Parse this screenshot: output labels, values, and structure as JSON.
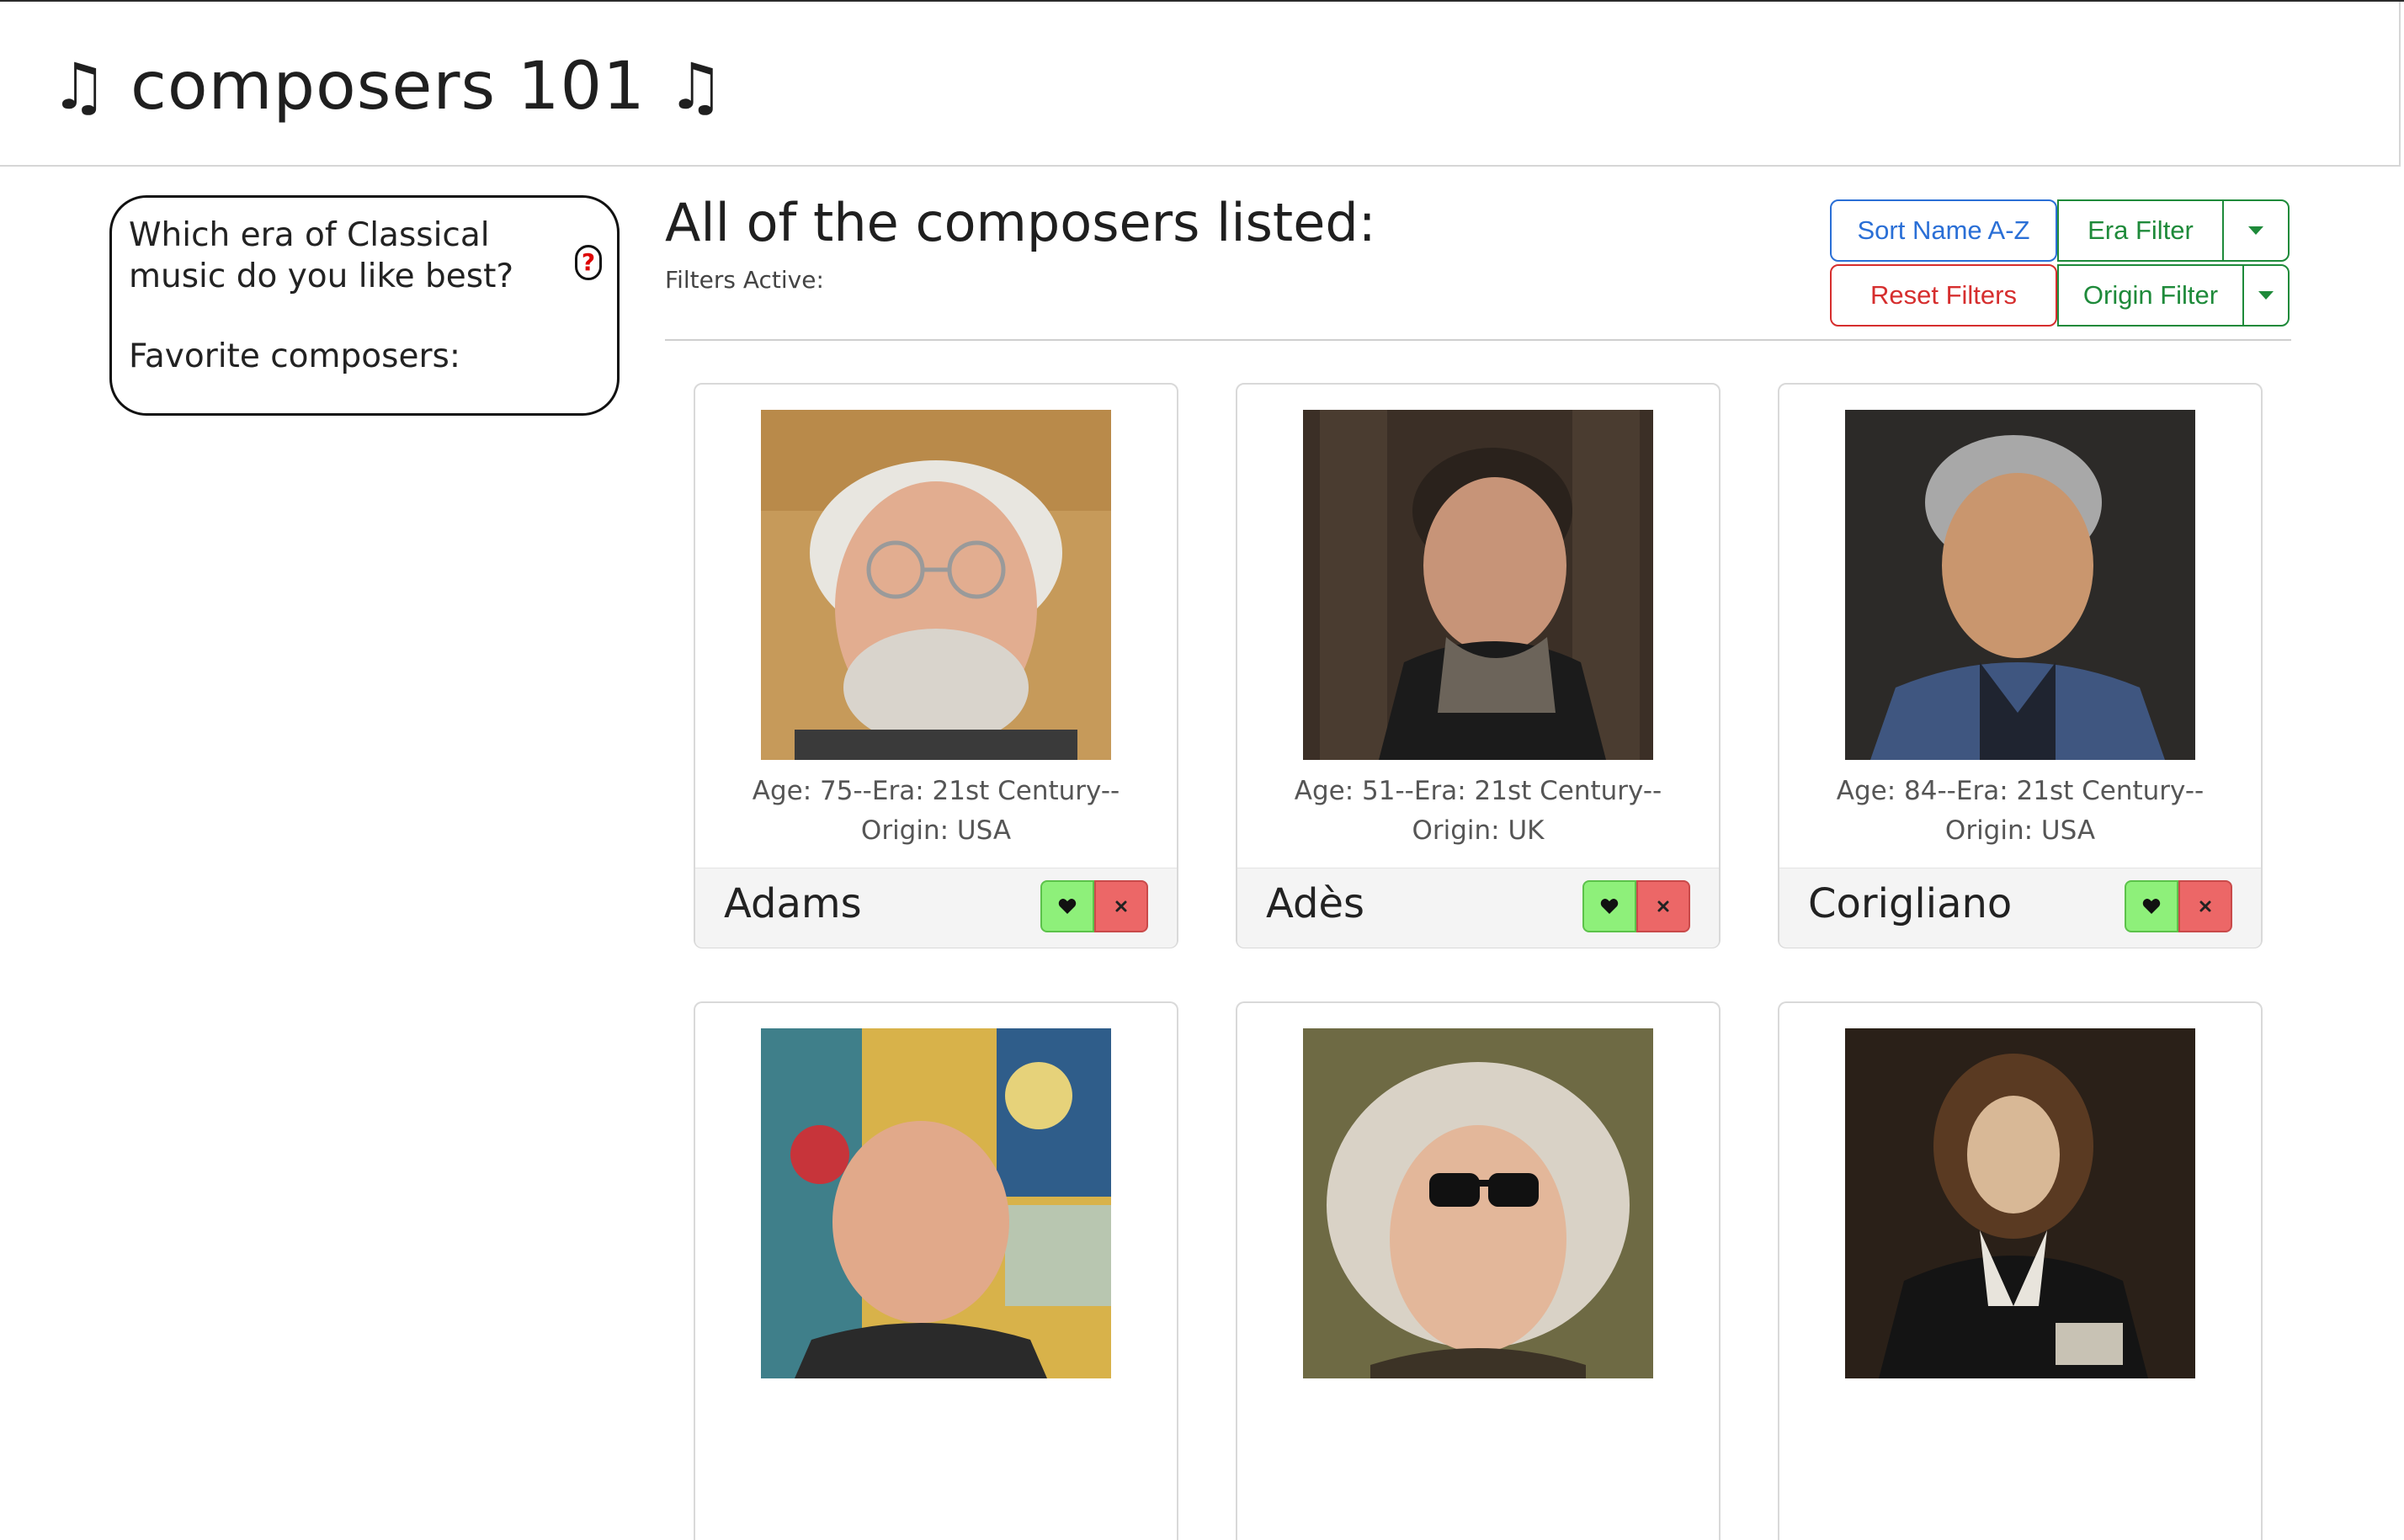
{
  "header": {
    "title": "composers 101",
    "note_left": "♫",
    "note_right": "♫"
  },
  "sidebar": {
    "question": "Which era of Classical music do you like best?",
    "help_symbol": "?",
    "favorites_label": "Favorite composers:"
  },
  "main": {
    "title": "All of the composers listed:",
    "filters_active_label": "Filters Active:"
  },
  "controls": {
    "sort_label": "Sort Name A-Z",
    "reset_label": "Reset Filters",
    "era_filter_label": "Era Filter",
    "origin_filter_label": "Origin Filter"
  },
  "colors": {
    "primary": "#2a6fd6",
    "danger": "#d62e2e",
    "success": "#1e8a3a",
    "favorite_button": "#8ef07a",
    "remove_button": "#ec6767"
  },
  "cards": [
    {
      "name": "Adams",
      "info_line1": "Age: 75--Era: 21st Century--",
      "info_line2": "Origin: USA"
    },
    {
      "name": "Adès",
      "info_line1": "Age: 51--Era: 21st Century--",
      "info_line2": "Origin: UK"
    },
    {
      "name": "Corigliano",
      "info_line1": "Age: 84--Era: 21st Century--",
      "info_line2": "Origin: USA"
    },
    {
      "name": "",
      "info_line1": "",
      "info_line2": ""
    },
    {
      "name": "",
      "info_line1": "",
      "info_line2": ""
    },
    {
      "name": "",
      "info_line1": "",
      "info_line2": ""
    }
  ]
}
